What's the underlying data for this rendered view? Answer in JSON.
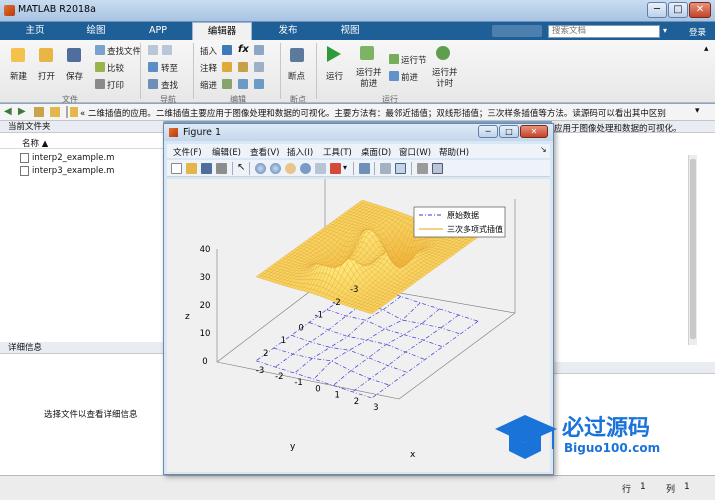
{
  "window": {
    "title": "MATLAB R2018a",
    "controls": [
      "─",
      "□",
      "✕"
    ]
  },
  "tabs": [
    {
      "label": "主页"
    },
    {
      "label": "绘图"
    },
    {
      "label": "APP"
    },
    {
      "label": "编辑器"
    },
    {
      "label": "发布"
    },
    {
      "label": "视图"
    }
  ],
  "search": {
    "placeholder": "搜索文档"
  },
  "login": "登录",
  "ribbon": {
    "file": {
      "new": "新建",
      "open": "打开",
      "save": "保存",
      "find_files": "查找文件",
      "compare": "比较",
      "print": "打印",
      "section": "文件"
    },
    "navigate": {
      "goto": "转至",
      "find": "查找",
      "section": "导航"
    },
    "edit": {
      "insert": "插入",
      "comment": "注释",
      "indent": "缩进",
      "fx": "fx",
      "section": "编辑"
    },
    "breakpoints": {
      "label": "断点",
      "section": "断点"
    },
    "run": {
      "run": "运行",
      "run_advance": "运行并\n前进",
      "run_section": "运行节",
      "advance": "前进",
      "run_time": "运行并\n计时",
      "section": "运行"
    }
  },
  "address": {
    "text": "« 二维插值的应用。二维插值主要应用于图像处理和数据的可视化。主要方法有：最邻近插值；双线形插值；三次样条插值等方法。读源码可以看出其中区别"
  },
  "left_panel": {
    "title": "当前文件夹",
    "column": "名称 ▲",
    "files": [
      "interp2_example.m",
      "interp3_example.m"
    ],
    "details_title": "详细信息",
    "details_text": "选择文件以查看详细信息"
  },
  "right_panel": {
    "partial_text": "应用于图像处理和数据的可视化。"
  },
  "figure": {
    "title": "Figure 1",
    "menus": [
      "文件(F)",
      "编辑(E)",
      "查看(V)",
      "插入(I)",
      "工具(T)",
      "桌面(D)",
      "窗口(W)",
      "帮助(H)"
    ],
    "legend": [
      "原始数据",
      "三次多项式插值"
    ]
  },
  "chart_data": {
    "type": "surface",
    "legend": [
      "原始数据",
      "三次多项式插值"
    ],
    "zlabel": "z",
    "xlabel": "x",
    "ylabel": "y",
    "z_ticks": [
      0,
      10,
      20,
      30,
      40
    ],
    "x_ticks": [
      -3,
      -2,
      -1,
      0,
      1,
      2,
      3
    ],
    "y_ticks": [
      -3,
      -2,
      -1,
      0,
      1,
      2
    ],
    "colors": {
      "original": "#3b3bd6",
      "interp": "#f1b43a"
    }
  },
  "status": {
    "row_label": "行",
    "row": "1",
    "col_label": "列",
    "col": "1"
  },
  "watermark": {
    "cn": "必过源码",
    "en": "Biguo100.com"
  }
}
